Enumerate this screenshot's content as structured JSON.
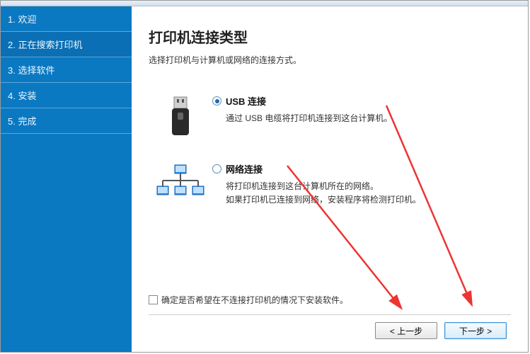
{
  "sidebar": {
    "items": [
      {
        "label": "1. 欢迎"
      },
      {
        "label": "2. 正在搜索打印机"
      },
      {
        "label": "3. 选择软件"
      },
      {
        "label": "4. 安装"
      },
      {
        "label": "5. 完成"
      }
    ]
  },
  "main": {
    "title": "打印机连接类型",
    "subtitle": "选择打印机与计算机或网络的连接方式。",
    "options": {
      "usb": {
        "label": "USB 连接",
        "desc": "通过 USB 电缆将打印机连接到这台计算机。"
      },
      "network": {
        "label": "网络连接",
        "desc_line1": "将打印机连接到这台计算机所在的网络。",
        "desc_line2": "如果打印机已连接到网络，安装程序将检测打印机。"
      }
    },
    "checkbox_label": "确定是否希望在不连接打印机的情况下安装软件。"
  },
  "footer": {
    "back": "< 上一步",
    "next": "下一步 >"
  }
}
